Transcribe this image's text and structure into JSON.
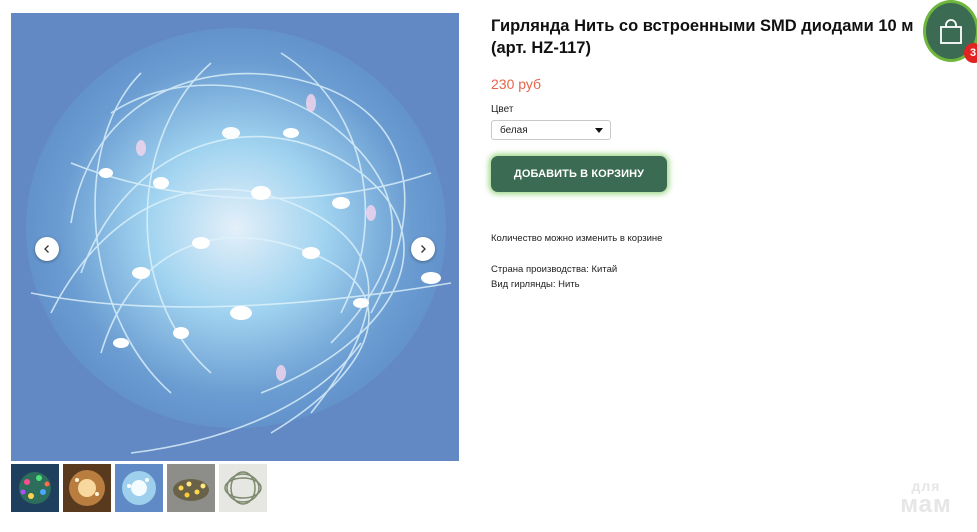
{
  "product": {
    "title": "Гирлянда Нить со встроенными SMD диодами 10 м (арт. HZ-117)",
    "price": "230 руб",
    "color_label": "Цвет",
    "color_selected": "белая",
    "add_to_cart_label": "ДОБАВИТЬ В КОРЗИНУ",
    "quantity_note": "Количество можно изменить в корзине",
    "specs": {
      "country": "Страна производства: Китай",
      "kind": "Вид гирлянды: Нить"
    }
  },
  "gallery": {
    "main_image": "blue-white-led-wire-garland-photo",
    "thumbnails": [
      {
        "image": "multicolor-led-garland-photo"
      },
      {
        "image": "warm-white-led-garland-photo"
      },
      {
        "image": "blue-white-led-garland-photo"
      },
      {
        "image": "yellow-led-garland-photo"
      },
      {
        "image": "unlit-wire-garland-photo"
      }
    ]
  },
  "cart": {
    "icon": "shopping-bag-icon",
    "badge_count": "3"
  },
  "watermark": {
    "line1": "для",
    "line2": "мам"
  },
  "colors": {
    "accent_green": "#3b6b52",
    "glow_green": "#6fb63c",
    "price_orange": "#e8644a",
    "badge_red": "#e32222"
  }
}
